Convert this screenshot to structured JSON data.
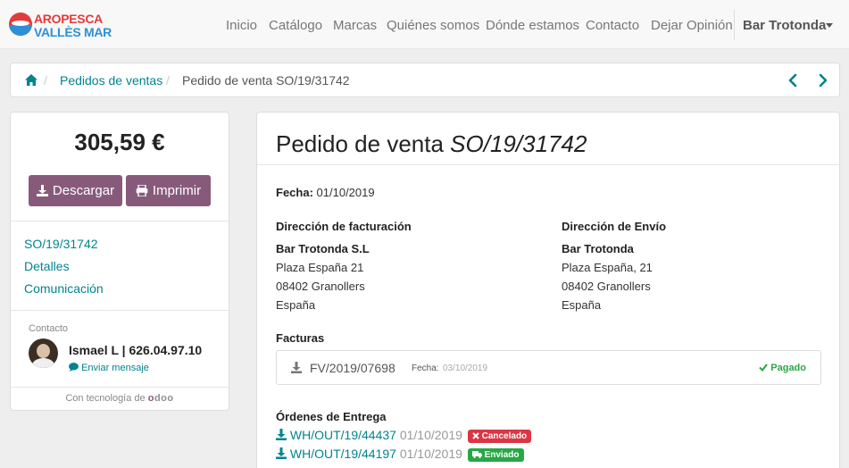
{
  "brand": {
    "line1": "AROPESCA",
    "line2": "VALLÈS MAR"
  },
  "nav": {
    "items": [
      "Inicio",
      "Catálogo",
      "Marcas",
      "Quiénes somos",
      "Dónde estamos",
      "Contacto",
      "Dejar Opinión"
    ],
    "user": "Bar Trotonda"
  },
  "breadcrumb": {
    "home_icon": "home-icon",
    "sep": "/",
    "link": "Pedidos de ventas",
    "current": "Pedido de venta SO/19/31742",
    "prev_icon": "chevron-left-icon",
    "next_icon": "chevron-right-icon"
  },
  "sidebar": {
    "amount": "305,59 €",
    "download_label": "Descargar",
    "print_label": "Imprimir",
    "links": [
      "SO/19/31742",
      "Detalles",
      "Comunicación"
    ],
    "contact_label": "Contacto",
    "contact_name": "Ismael L | 626.04.97.10",
    "send_message": "Enviar mensaje",
    "powered_prefix": "Con tecnología de",
    "powered_brand_o": "o",
    "powered_brand_rest": "doo"
  },
  "order": {
    "title_prefix": "Pedido de venta",
    "title_ref": "SO/19/31742",
    "date_label": "Fecha:",
    "date_value": "01/10/2019",
    "billing": {
      "title": "Dirección de facturación",
      "name": "Bar Trotonda S.L",
      "street": "Plaza España 21",
      "city": "08402 Granollers",
      "country": "España"
    },
    "shipping": {
      "title": "Dirección de Envío",
      "name": "Bar Trotonda",
      "street": "Plaza España, 21",
      "city": "08402 Granollers",
      "country": "España"
    },
    "invoices_title": "Facturas",
    "invoice": {
      "number": "FV/2019/07698",
      "date_label": "Fecha:",
      "date": "03/10/2019",
      "status": "Pagado"
    },
    "deliveries_title": "Órdenes de Entrega",
    "deliveries": [
      {
        "ref": "WH/OUT/19/44437",
        "date": "01/10/2019",
        "status": "Cancelado"
      },
      {
        "ref": "WH/OUT/19/44197",
        "date": "01/10/2019",
        "status": "Enviado"
      }
    ]
  },
  "colors": {
    "accent": "#00848f",
    "primary_button": "#875a7b",
    "paid": "#28a745",
    "cancelled": "#dc3545",
    "sent": "#28a745"
  }
}
